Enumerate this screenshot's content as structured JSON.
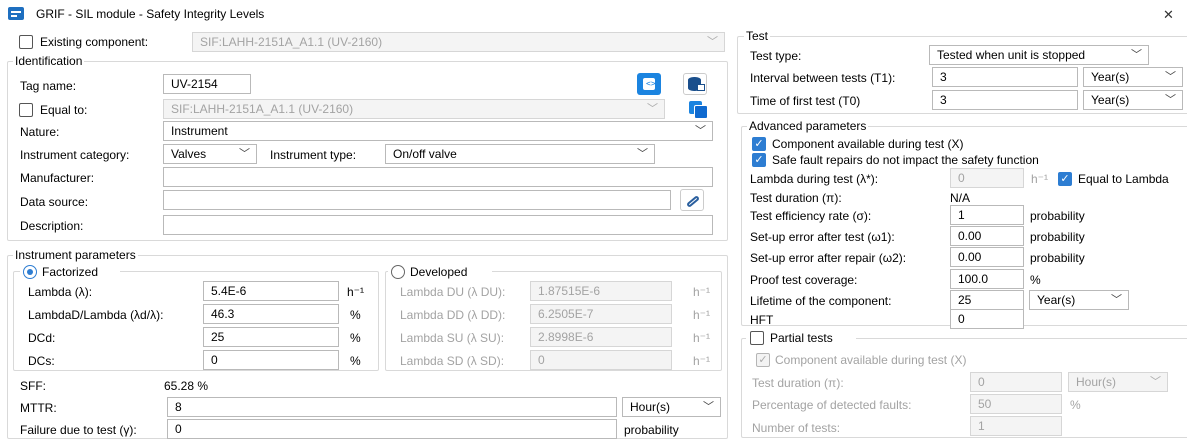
{
  "window": {
    "title": "GRIF - SIL module - Safety Integrity Levels",
    "close_glyph": "✕"
  },
  "existing": {
    "label": "Existing component:",
    "value": "SIF:LAHH-2151A_A1.1 (UV-2160)"
  },
  "identification": {
    "title": "Identification",
    "tag_label": "Tag name:",
    "tag_value": "UV-2154",
    "equal_label": "Equal to:",
    "equal_value": "SIF:LAHH-2151A_A1.1 (UV-2160)",
    "nature_label": "Nature:",
    "nature_value": "Instrument",
    "category_label": "Instrument category:",
    "category_value": "Valves",
    "type_label": "Instrument type:",
    "type_value": "On/off valve",
    "manufacturer_label": "Manufacturer:",
    "manufacturer_value": "",
    "datasource_label": "Data source:",
    "datasource_value": "",
    "description_label": "Description:",
    "description_value": ""
  },
  "instrument": {
    "title": "Instrument parameters",
    "factorized": {
      "title": "Factorized",
      "rows": [
        {
          "label": "Lambda (λ):",
          "value": "5.4E-6",
          "unit": "h⁻¹"
        },
        {
          "label": "LambdaD/Lambda (λd/λ):",
          "value": "46.3",
          "unit": "%"
        },
        {
          "label": "DCd:",
          "value": "25",
          "unit": "%"
        },
        {
          "label": "DCs:",
          "value": "0",
          "unit": "%"
        }
      ]
    },
    "developed": {
      "title": "Developed",
      "rows": [
        {
          "label": "Lambda DU (λ DU):",
          "value": "1.87515E-6",
          "unit": "h⁻¹"
        },
        {
          "label": "Lambda DD (λ DD):",
          "value": "6.2505E-7",
          "unit": "h⁻¹"
        },
        {
          "label": "Lambda SU (λ SU):",
          "value": "2.8998E-6",
          "unit": "h⁻¹"
        },
        {
          "label": "Lambda SD (λ SD):",
          "value": "0",
          "unit": "h⁻¹"
        }
      ]
    },
    "sff_label": "SFF:",
    "sff_value": "65.28 %",
    "mttr_label": "MTTR:",
    "mttr_value": "8",
    "mttr_unit": "Hour(s)",
    "failure_label": "Failure due to test (γ):",
    "failure_value": "0",
    "failure_unit": "probability"
  },
  "test": {
    "title": "Test",
    "type_label": "Test type:",
    "type_value": "Tested when unit is stopped",
    "interval_label": "Interval between tests (T1):",
    "interval_value": "3",
    "interval_unit": "Year(s)",
    "first_label": "Time of first test (T0)",
    "first_value": "3",
    "first_unit": "Year(s)"
  },
  "advanced": {
    "title": "Advanced parameters",
    "available_label": "Component available during test (X)",
    "safe_label": "Safe fault repairs do not impact the safety function",
    "lambda_label": "Lambda during test (λ*):",
    "lambda_value": "0",
    "lambda_unit": "h⁻¹",
    "equal_lambda_label": "Equal to Lambda",
    "duration_label": "Test duration (π):",
    "duration_value": "N/A",
    "efficiency_label": "Test efficiency rate (σ):",
    "efficiency_value": "1",
    "efficiency_unit": "probability",
    "setup1_label": "Set-up error after test (ω1):",
    "setup1_value": "0.00",
    "setup1_unit": "probability",
    "setup2_label": "Set-up error after repair (ω2):",
    "setup2_value": "0.00",
    "setup2_unit": "probability",
    "coverage_label": "Proof test coverage:",
    "coverage_value": "100.0",
    "coverage_unit": "%",
    "lifetime_label": "Lifetime of the component:",
    "lifetime_value": "25",
    "lifetime_unit": "Year(s)",
    "hft_label": "HFT",
    "hft_value": "0"
  },
  "partial": {
    "title": "Partial tests",
    "available_label": "Component available during test (X)",
    "duration_label": "Test duration (π):",
    "duration_value": "0",
    "duration_unit": "Hour(s)",
    "percent_label": "Percentage of detected faults:",
    "percent_value": "50",
    "percent_unit": "%",
    "number_label": "Number of tests:",
    "number_value": "1"
  }
}
